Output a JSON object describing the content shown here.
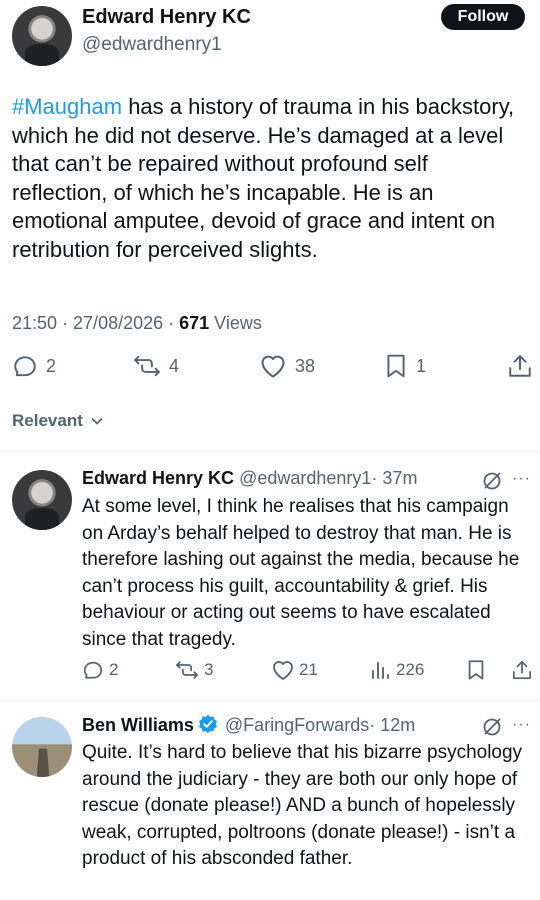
{
  "post": {
    "author_name": "Edward Henry KC",
    "author_handle": "@edwardhenry1",
    "follow_label": "Follow",
    "hashtag": "#Maugham",
    "body": " has a history of trauma in his backstory, which he did not deserve. He’s damaged at a level that can’t be repaired without profound self reflection, of which he’s incapable. He is an emotional amputee, devoid of grace and intent on retribution for perceived slights.",
    "timestamp": "21:50 · 27/08/2026 · ",
    "views_count": "671",
    "views_label": " Views",
    "actions": {
      "replies": "2",
      "reposts": "4",
      "likes": "38",
      "bookmarks": "1"
    }
  },
  "sort": {
    "label": "Relevant"
  },
  "replies": [
    {
      "name": "Edward Henry KC",
      "handle": "@edwardhenry1",
      "time": "· 37m",
      "verified": false,
      "body": "At some level, I think he realises that his campaign on Arday’s behalf helped to destroy that man. He is therefore lashing out against the media, because he can’t process his guilt, accountability & grief. His behaviour or acting out seems to have escalated since that tragedy.",
      "actions": {
        "replies": "2",
        "reposts": "3",
        "likes": "21",
        "views": "226"
      }
    },
    {
      "name": "Ben Williams",
      "handle": "@FaringForwards",
      "time": "· 12m",
      "verified": true,
      "body": "Quite. It’s hard to believe that his bizarre psychology around the judiciary - they are both our only hope of rescue  (donate please!) AND  a bunch of hopelessly weak, corrupted, poltroons (donate please!) - isn’t a product of his absconded father."
    }
  ],
  "more_glyph": "···",
  "colors": {
    "accent": "#1d9bf0",
    "text": "#0f1419",
    "muted": "#536471"
  }
}
